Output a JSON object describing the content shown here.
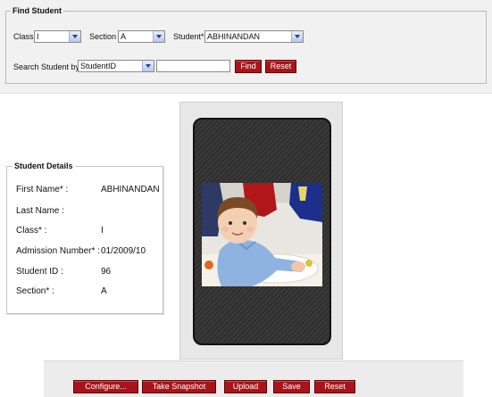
{
  "find_student": {
    "legend": "Find Student",
    "class_label": "Class",
    "class_value": "I",
    "section_label": "Section",
    "section_value": "A",
    "student_label": "Student*",
    "student_value": "ABHINANDAN",
    "search_by_label": "Search Student by*",
    "search_by_value": "StudentID",
    "search_text": "",
    "find_button": "Find",
    "reset_button": "Reset"
  },
  "student_details": {
    "legend": "Student Details",
    "first_name_label": "First Name* :",
    "first_name_value": "ABHINANDAN",
    "last_name_label": "Last Name :",
    "last_name_value": "",
    "class_label": "Class* :",
    "class_value": "I",
    "admission_label": "Admission Number* :",
    "admission_value": "01/2009/10",
    "student_id_label": "Student ID :",
    "student_id_value": "96",
    "section_label": "Section* :",
    "section_value": "A"
  },
  "camera_actions": {
    "configure": "Configure...",
    "take_snapshot": "Take Snapshot",
    "upload": "Upload",
    "save": "Save",
    "reset": "Reset"
  },
  "colors": {
    "button_red": "#a8141b",
    "select_arrow": "#1f3f8f",
    "panel_bg": "#f1f1f1"
  }
}
